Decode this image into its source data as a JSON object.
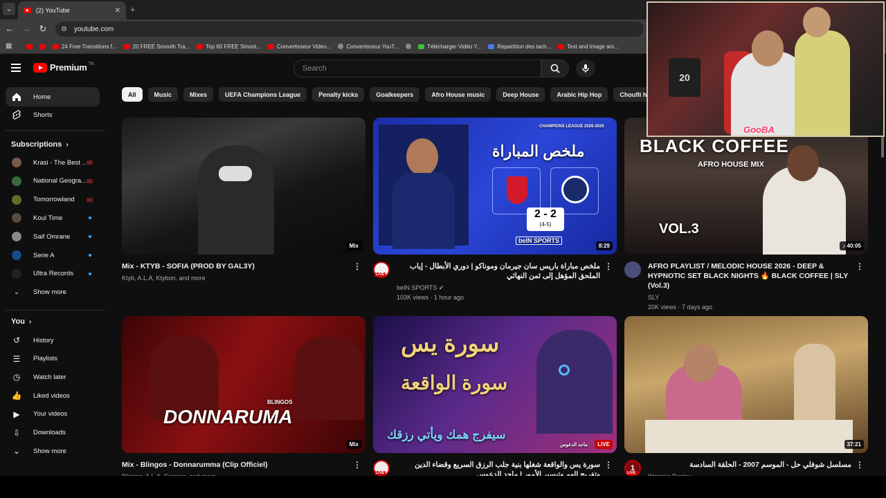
{
  "browser": {
    "tab_title": "(2) YouTube",
    "url": "youtube.com",
    "bookmarks": [
      {
        "label": "",
        "icon": "youtube-icon"
      },
      {
        "label": "",
        "icon": "youtube-icon"
      },
      {
        "label": "24 Free Transitions f...",
        "icon": "youtube-icon"
      },
      {
        "label": "20 FREE Smooth Tra...",
        "icon": "youtube-icon"
      },
      {
        "label": "Top 60 FREE Smoot...",
        "icon": "youtube-icon"
      },
      {
        "label": "Convertisseur Video...",
        "icon": "youtube-icon"
      },
      {
        "label": "Convertisseur YouT...",
        "icon": "converter-icon"
      },
      {
        "label": "",
        "icon": "globe-icon"
      },
      {
        "label": "Télécharger Vidéo Y...",
        "icon": "download-icon"
      },
      {
        "label": "Repartition des tach...",
        "icon": "doc-icon"
      },
      {
        "label": "Text and Image ani...",
        "icon": "youtube-icon"
      }
    ]
  },
  "header": {
    "logo": "Premium",
    "logo_tag": "TN",
    "search_placeholder": "Search"
  },
  "sidebar": {
    "main": [
      {
        "label": "Home",
        "icon": "home-icon"
      },
      {
        "label": "Shorts",
        "icon": "shorts-icon"
      }
    ],
    "subscriptions_heading": "Subscriptions",
    "subscriptions": [
      {
        "label": "Krasi - The Best ...",
        "indicator": "live"
      },
      {
        "label": "National Geogra...",
        "indicator": "live"
      },
      {
        "label": "Tomorrowland",
        "indicator": "live"
      },
      {
        "label": "Koul Time",
        "indicator": "dot"
      },
      {
        "label": "Saif Omrane",
        "indicator": "dot"
      },
      {
        "label": "Serie A",
        "indicator": "dot"
      },
      {
        "label": "Ultra Records",
        "indicator": "dot"
      },
      {
        "label": "Show more",
        "indicator": "none"
      }
    ],
    "you_heading": "You",
    "you": [
      {
        "label": "History",
        "icon": "history-icon"
      },
      {
        "label": "Playlists",
        "icon": "playlists-icon"
      },
      {
        "label": "Watch later",
        "icon": "watch-later-icon"
      },
      {
        "label": "Liked videos",
        "icon": "like-icon"
      },
      {
        "label": "Your videos",
        "icon": "your-videos-icon"
      },
      {
        "label": "Downloads",
        "icon": "download-icon"
      },
      {
        "label": "Show more",
        "icon": "chevron-down-icon"
      }
    ]
  },
  "chips": [
    "All",
    "Music",
    "Mixes",
    "UEFA Champions League",
    "Penalty kicks",
    "Goalkeepers",
    "Afro House music",
    "Deep House",
    "Arabic Hip Hop",
    "Choufli hal"
  ],
  "videos": [
    {
      "title": "Mix - KTYB - SOFIA (PROD BY GAL3Y)",
      "sub1": "Ktyb, A.L.A, Ktybon, and more",
      "sub2": "",
      "badge": "Mix",
      "overlay": ""
    },
    {
      "title": "ملخص مباراة باريس سان جيرمان وموناكو | دوري الأبطال - إياب الملحق المؤهل إلى ثمن النهائي",
      "sub1": "beIN SPORTS",
      "sub2": "103K views · 1 hour ago",
      "badge": "8:29",
      "overlay": "ملخص المباراة",
      "score": "2 - 2",
      "score_sub": "(4-5)",
      "league": "CHAMPIONS LEAGUE 2026-2025",
      "broadcaster": "beIN SPORTS",
      "live_tag": "LIVE"
    },
    {
      "title": "AFRO PLAYLIST / MELODIC HOUSE 2026 - DEEP & HYPNOTIC SET BLACK NIGHTS 🔥 BLACK COFFEE | SLY (Vol.3)",
      "sub1": "SLY",
      "sub2": "20K views · 7 days ago",
      "badge": "40:05",
      "overlay": "BLACK COFFEE",
      "overlay2": "AFRO HOUSE MIX",
      "overlay3": "VOL.3"
    },
    {
      "title": "Mix - Blingos - Donnarumma (Clip Officiel)",
      "sub1": "Blingos, A.L.A, Samara, and more",
      "sub2": "",
      "badge": "Mix",
      "overlay": "DONNARUMA",
      "overlay2": "BLINGOS"
    },
    {
      "title": "سورة يس والواقعة شغلها بنية جلب الرزق السريع وقضاء الدين وتفريج الهم وتيسير الأمور | ماجد الدعوس",
      "sub1": "",
      "sub2": "",
      "badge": "LIVE",
      "overlay": "سورة يس",
      "overlay2": "سورة الواقعة",
      "overlay3": "سيفرج همك ويأتي رزقك",
      "overlay4": "ماجد الدعوس",
      "live_tag": "LIVE"
    },
    {
      "title": "مسلسل شوفلي حل - الموسم 2007 - الحلقة السادسة",
      "sub1": "Watania Replay",
      "sub2": "",
      "badge": "37:21",
      "overlay": "",
      "live_tag": "LIVE"
    }
  ],
  "cam_overlay": {
    "name_tag": "GooBA",
    "jersey_number": "20"
  }
}
